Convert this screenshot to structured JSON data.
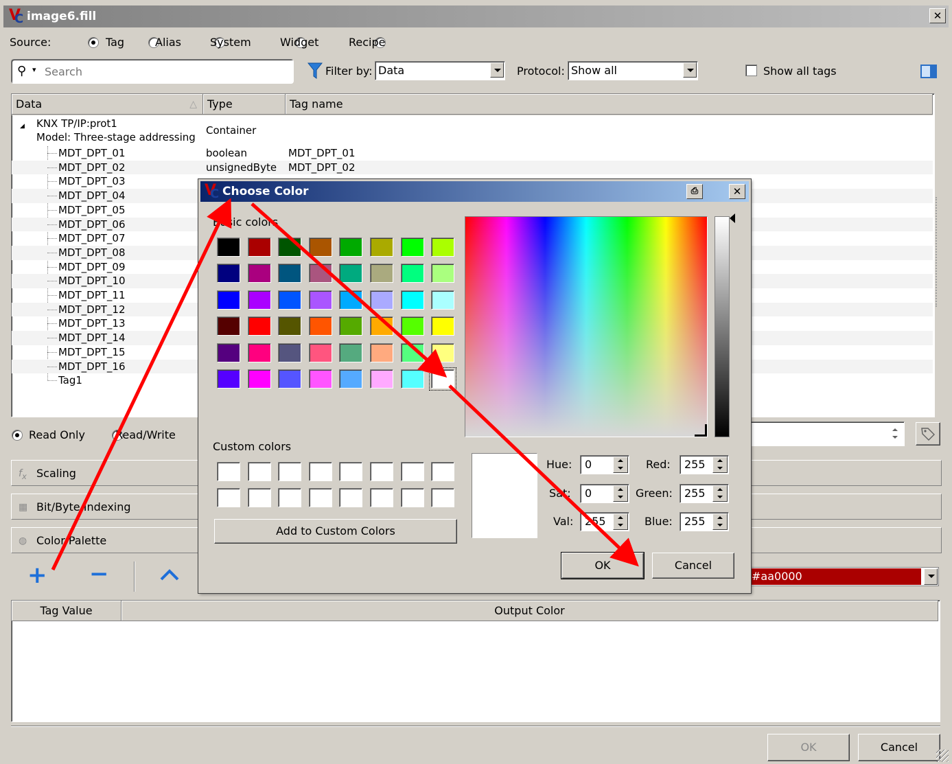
{
  "window": {
    "title": "image6.fill",
    "close_glyph": "✕"
  },
  "source": {
    "label": "Source:",
    "options": [
      "Tag",
      "Alias",
      "System",
      "Widget",
      "Recipe"
    ],
    "selected": "Tag"
  },
  "search": {
    "placeholder": "Search"
  },
  "filter": {
    "label": "Filter by:",
    "value": "Data"
  },
  "protocol": {
    "label": "Protocol:",
    "value": "Show all"
  },
  "show_all_tags": {
    "label": "Show all tags",
    "checked": false
  },
  "table": {
    "headers": [
      "Data",
      "Type",
      "Tag name"
    ],
    "root": {
      "line1": "KNX TP/IP:prot1",
      "line2": "Model: Three-stage addressing",
      "type": "Container"
    },
    "rows": [
      {
        "name": "MDT_DPT_01",
        "type": "boolean",
        "tag": "MDT_DPT_01"
      },
      {
        "name": "MDT_DPT_02",
        "type": "unsignedByte",
        "tag": "MDT_DPT_02"
      },
      {
        "name": "MDT_DPT_03",
        "type": "",
        "tag": ""
      },
      {
        "name": "MDT_DPT_04",
        "type": "",
        "tag": ""
      },
      {
        "name": "MDT_DPT_05",
        "type": "",
        "tag": ""
      },
      {
        "name": "MDT_DPT_06",
        "type": "",
        "tag": ""
      },
      {
        "name": "MDT_DPT_07",
        "type": "",
        "tag": ""
      },
      {
        "name": "MDT_DPT_08",
        "type": "",
        "tag": ""
      },
      {
        "name": "MDT_DPT_09",
        "type": "",
        "tag": ""
      },
      {
        "name": "MDT_DPT_10",
        "type": "",
        "tag": ""
      },
      {
        "name": "MDT_DPT_11",
        "type": "",
        "tag": ""
      },
      {
        "name": "MDT_DPT_12",
        "type": "",
        "tag": ""
      },
      {
        "name": "MDT_DPT_13",
        "type": "",
        "tag": ""
      },
      {
        "name": "MDT_DPT_14",
        "type": "",
        "tag": ""
      },
      {
        "name": "MDT_DPT_15",
        "type": "",
        "tag": ""
      },
      {
        "name": "MDT_DPT_16",
        "type": "",
        "tag": ""
      },
      {
        "name": "Tag1",
        "type": "",
        "tag": ""
      }
    ]
  },
  "access": {
    "read_only": "Read Only",
    "read_write": "Read/Write"
  },
  "sections": {
    "scaling": "Scaling",
    "bit_byte": "Bit/Byte Indexing",
    "color_palette": "Color Palette"
  },
  "palette": {
    "add_glyph": "+",
    "remove_glyph": "−",
    "up_glyph": "⌃",
    "color_value": "#aa0000",
    "color_hex": "#aa0000",
    "headers": [
      "Tag Value",
      "Output Color"
    ]
  },
  "footer": {
    "ok": "OK",
    "cancel": "Cancel"
  },
  "dialog": {
    "title": "Choose Color",
    "basic_colors_label": "Basic colors",
    "custom_colors_label": "Custom colors",
    "add_custom": "Add to Custom Colors",
    "basic_colors": [
      "#000000",
      "#aa0000",
      "#005500",
      "#aa5500",
      "#00aa00",
      "#aaaa00",
      "#00ff00",
      "#aaff00",
      "#00007f",
      "#aa007f",
      "#00557f",
      "#aa557f",
      "#00aa7f",
      "#aaaa7f",
      "#00ff7f",
      "#aaff7f",
      "#0000ff",
      "#aa00ff",
      "#0055ff",
      "#aa55ff",
      "#00aaff",
      "#aaaaff",
      "#00ffff",
      "#aaffff",
      "#550000",
      "#ff0000",
      "#555500",
      "#ff5500",
      "#55aa00",
      "#ffaa00",
      "#55ff00",
      "#ffff00",
      "#55007f",
      "#ff007f",
      "#55557f",
      "#ff557f",
      "#55aa7f",
      "#ffaa7f",
      "#55ff7f",
      "#ffff7f",
      "#5500ff",
      "#ff00ff",
      "#5555ff",
      "#ff55ff",
      "#55aaff",
      "#ffaaff",
      "#55ffff",
      "#ffffff"
    ],
    "selected_index": 47,
    "hue_label": "Hue:",
    "hue": "0",
    "sat_label": "Sat:",
    "sat": "0",
    "val_label": "Val:",
    "val": "255",
    "red_label": "Red:",
    "red": "255",
    "green_label": "Green:",
    "green": "255",
    "blue_label": "Blue:",
    "blue": "255",
    "ok": "OK",
    "cancel": "Cancel",
    "annotation_color": "#ff0000"
  }
}
